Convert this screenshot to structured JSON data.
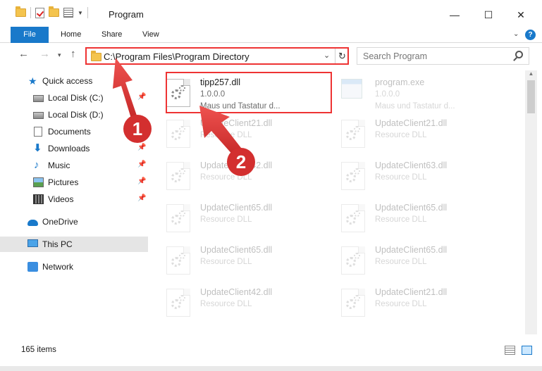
{
  "window": {
    "title": "Program",
    "minimize": "—",
    "maximize": "☐",
    "close": "✕"
  },
  "ribbon": {
    "tabs": [
      "File",
      "Home",
      "Share",
      "View"
    ],
    "help": "?"
  },
  "address_bar": {
    "path": "C:\\Program Files\\Program Directory",
    "refresh": "↻"
  },
  "search": {
    "placeholder": "Search Program"
  },
  "sidebar": {
    "items": [
      {
        "label": "Quick access",
        "icon": "star-icon",
        "pinned": false
      },
      {
        "label": "Local Disk (C:)",
        "icon": "disk-icon",
        "pinned": true
      },
      {
        "label": "Local Disk (D:)",
        "icon": "disk-icon",
        "pinned": true
      },
      {
        "label": "Documents",
        "icon": "document-icon",
        "pinned": true
      },
      {
        "label": "Downloads",
        "icon": "download-icon",
        "pinned": true
      },
      {
        "label": "Music",
        "icon": "music-icon",
        "pinned": true
      },
      {
        "label": "Pictures",
        "icon": "pictures-icon",
        "pinned": true
      },
      {
        "label": "Videos",
        "icon": "videos-icon",
        "pinned": true
      },
      {
        "label": "OneDrive",
        "icon": "onedrive-icon",
        "pinned": false
      },
      {
        "label": "This PC",
        "icon": "pc-icon",
        "pinned": false,
        "selected": true
      },
      {
        "label": "Network",
        "icon": "network-icon",
        "pinned": false
      }
    ]
  },
  "files": [
    {
      "name": "tipp257.dll",
      "line1": "1.0.0.0",
      "line2": "Maus und Tastatur d...",
      "highlighted": true
    },
    {
      "name": "program.exe",
      "line1": "1.0.0.0",
      "line2": "Maus und Tastatur d..."
    },
    {
      "name": "UpdateClient21.dll",
      "line1": "Resource DLL"
    },
    {
      "name": "UpdateClient21.dll",
      "line1": "Resource DLL"
    },
    {
      "name": "UpdateClient42.dll",
      "line1": "Resource DLL"
    },
    {
      "name": "UpdateClient63.dll",
      "line1": "Resource DLL"
    },
    {
      "name": "UpdateClient65.dll",
      "line1": "Resource DLL"
    },
    {
      "name": "UpdateClient65.dll",
      "line1": "Resource DLL"
    },
    {
      "name": "UpdateClient65.dll",
      "line1": "Resource DLL"
    },
    {
      "name": "UpdateClient65.dll",
      "line1": "Resource DLL"
    },
    {
      "name": "UpdateClient42.dll",
      "line1": "Resource DLL"
    },
    {
      "name": "UpdateClient21.dll",
      "line1": "Resource DLL"
    }
  ],
  "status": {
    "item_count": "165 items"
  },
  "annotations": {
    "callout_1": "1",
    "callout_2": "2",
    "color": "#e53935"
  },
  "colors": {
    "accent": "#1979ca",
    "highlight_red": "#ee3333"
  }
}
